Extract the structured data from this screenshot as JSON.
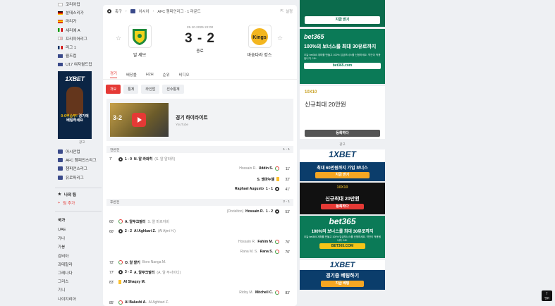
{
  "sidebar": {
    "leagues": [
      {
        "label": "코리아컵",
        "flag": "kr"
      },
      {
        "label": "분데스리가",
        "flag": "de"
      },
      {
        "label": "라리가",
        "flag": "es"
      },
      {
        "label": "세리에 A",
        "flag": "it"
      },
      {
        "label": "프리미어리그",
        "flag": "en"
      },
      {
        "label": "리그 1",
        "flag": "fr"
      },
      {
        "label": "월드컵",
        "flag": "wc"
      },
      {
        "label": "U17 여자월드컵",
        "flag": "wc"
      }
    ],
    "ad": {
      "brand": "1XBET",
      "text_pre": "0-0무승부!",
      "text_mid": "경기에",
      "text_post": "배팅하세요",
      "label": "광고"
    },
    "competitions": [
      "아시안컵",
      "AFC 챔피언스리그",
      "챔피언스리그",
      "유로파리그"
    ],
    "my_team_title": "나의 팀",
    "add_team": "팀 추가",
    "countries_title": "국가",
    "countries": [
      "UAE",
      "가나",
      "가봉",
      "감비아",
      "과테말라",
      "그레나다",
      "그리스",
      "기니",
      "나이지리아"
    ]
  },
  "breadcrumb": {
    "home": "축구",
    "region": "아시아",
    "round": "AFC 챔피언리그 · 1 라운드",
    "settings": "설정"
  },
  "match": {
    "datetime": "25.10.2025 22:00",
    "score": "3 - 2",
    "status": "종료",
    "home": {
      "name": "알 세브"
    },
    "away": {
      "name": "바숭다라 킹스",
      "logo_text": "Kings"
    }
  },
  "tabs": [
    "경기",
    "배당률",
    "H2H",
    "순위",
    "비디오"
  ],
  "chips": [
    "개요",
    "통계",
    "라인업",
    "선수통계"
  ],
  "highlight": {
    "thumb_score": "3-2",
    "title": "경기 하이라이트",
    "source": "YouTube"
  },
  "first_half": {
    "label": "전반전",
    "score": "1 - 1",
    "events": [
      {
        "side": "l",
        "minute": "7'",
        "icon": "goal",
        "score": "1 - 0",
        "player": "N. 알 라와히",
        "assist": "(S. 알 알라위)"
      },
      {
        "side": "r",
        "minute": "11'",
        "icon": "sub",
        "player": "Uddin S.",
        "secondary": "Hossain R."
      },
      {
        "side": "r",
        "minute": "32'",
        "icon": "yellow",
        "player": "S. 엠마누엘"
      },
      {
        "side": "r",
        "minute": "41'",
        "icon": "goal",
        "score": "1 - 1",
        "player": "Raphael Augusto"
      }
    ]
  },
  "second_half": {
    "label": "후반전",
    "score": "2 - 1",
    "events": [
      {
        "side": "r",
        "minute": "53'",
        "icon": "goal",
        "score": "1 - 2",
        "player": "Hossain R.",
        "assist": "(Dorielton)"
      },
      {
        "side": "l",
        "minute": "60'",
        "icon": "sub",
        "player": "A. 알무크발리",
        "secondary": "S. 알 마르자비"
      },
      {
        "side": "l",
        "minute": "60'",
        "icon": "goal",
        "score": "2 - 2",
        "player": "Al Aghbari Z.",
        "assist": "(Al Ajmi H.)"
      },
      {
        "side": "r",
        "minute": "70'",
        "icon": "sub",
        "player": "Fahim M.",
        "secondary": "Hossain R."
      },
      {
        "side": "r",
        "minute": "70'",
        "icon": "sub",
        "player": "Rana S.",
        "secondary": "Rana M. S."
      },
      {
        "side": "l",
        "minute": "72'",
        "icon": "sub",
        "player": "O. 알 할키",
        "secondary": "Boro Nanga M."
      },
      {
        "side": "l",
        "minute": "77'",
        "icon": "goal",
        "score": "3 - 2",
        "player": "A. 알무크발리",
        "assist": "(A. 알 부사이디)"
      },
      {
        "side": "l",
        "minute": "83'",
        "icon": "yellow",
        "player": "Al Shaqsy M."
      },
      {
        "side": "r",
        "minute": "83'",
        "icon": "sub",
        "player": "Mitchell C.",
        "secondary": "Ridoy M."
      },
      {
        "side": "l",
        "minute": "85'",
        "icon": "sub",
        "player": "Al Balushi A.",
        "secondary": "Al Aghbari Z."
      }
    ]
  },
  "right_ads": {
    "ad1_btn": "지금 받기",
    "bet365_brand": "bet365",
    "bet365_headline": "100%의 보너스를 최대 30유로까지",
    "bet365_fine": "오늘 bet365 계좌를 만들고 100% 입금보너스를 신청하세요. 약관이 적용됩니다. 18+",
    "bet365_site": "bet365.com",
    "tenx_brand": "10X10",
    "tenx_headline": "신규최대 20만원",
    "tenx_btn": "등록하다",
    "label": "광고",
    "xbet_brand": "1XBET",
    "xbet_headline": "최대 60만원까지 가입 보너스",
    "xbet_btn": "지금 받기",
    "tenx2_headline": "신규최대 20만원",
    "tenx2_btn": "등록하다",
    "bet365_2_headline": "100%의 보너스를 최대 30유로까지",
    "bet365_2_fine": "오늘 bet365 계좌를 만들고 100% 입금보너스를 신청하세요. 약관이 적용됩니다. 18+",
    "bet365_2_site": "BET365.COM",
    "xbet2_headline": "경기중 베팅하기",
    "xbet2_btn": "지금 베팅"
  },
  "back_to_top": "맨위",
  "colors": {
    "accent": "#e53935",
    "bet365": "#0b7a57",
    "xbet": "#0b3d6b",
    "tenx": "#111111"
  }
}
